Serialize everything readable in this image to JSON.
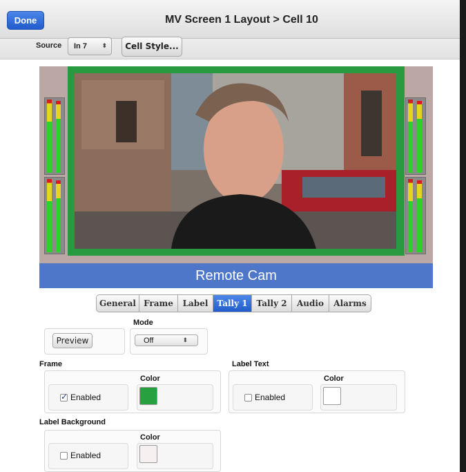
{
  "titlebar": {
    "done_label": "Done",
    "title": "MV Screen 1 Layout > Cell 10"
  },
  "toolbar": {
    "source_label": "Source",
    "source_value": "In 7",
    "cell_style_label": "Cell Style..."
  },
  "cell": {
    "label_text": "Remote Cam",
    "frame_color": "#2a9a41",
    "label_bg_color": "#4e76c9"
  },
  "tabs": [
    {
      "label": "General",
      "active": false
    },
    {
      "label": "Frame",
      "active": false
    },
    {
      "label": "Label",
      "active": false
    },
    {
      "label": "Tally 1",
      "active": true
    },
    {
      "label": "Tally 2",
      "active": false
    },
    {
      "label": "Audio",
      "active": false
    },
    {
      "label": "Alarms",
      "active": false
    }
  ],
  "mode": {
    "label": "Mode",
    "value": "Off"
  },
  "preview_label": "Preview",
  "frame_section": {
    "title": "Frame",
    "enabled_label": "Enabled",
    "enabled": true,
    "color_label": "Color",
    "color": "#27a040"
  },
  "label_text_section": {
    "title": "Label Text",
    "enabled_label": "Enabled",
    "enabled": false,
    "color_label": "Color",
    "color": "#ffffff"
  },
  "label_bg_section": {
    "title": "Label Background",
    "enabled_label": "Enabled",
    "enabled": false,
    "color_label": "Color",
    "color": "#f7f0f0"
  },
  "icons": {
    "select_arrow": "updown-chevron-icon",
    "checkbox": "checkmark-icon"
  }
}
